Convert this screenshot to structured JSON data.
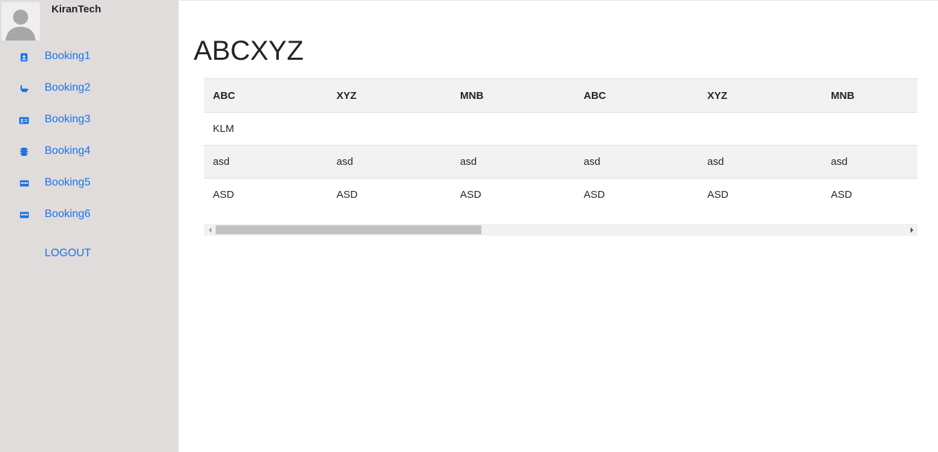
{
  "user": {
    "name": "KiranTech"
  },
  "sidebar": {
    "items": [
      {
        "label": "Booking1",
        "icon": "id-badge-icon"
      },
      {
        "label": "Booking2",
        "icon": "bath-icon"
      },
      {
        "label": "Booking3",
        "icon": "id-card-icon"
      },
      {
        "label": "Booking4",
        "icon": "microchip-icon"
      },
      {
        "label": "Booking5",
        "icon": "credit-card-icon"
      },
      {
        "label": "Booking6",
        "icon": "credit-card-icon"
      }
    ],
    "logout": "LOGOUT"
  },
  "main": {
    "title": "ABCXYZ",
    "table": {
      "headers": [
        "ABC",
        "XYZ",
        "MNB",
        "ABC",
        "XYZ",
        "MNB"
      ],
      "rows": [
        [
          "KLM",
          "",
          "",
          "",
          "",
          ""
        ],
        [
          "asd",
          "asd",
          "asd",
          "asd",
          "asd",
          "asd"
        ],
        [
          "ASD",
          "ASD",
          "ASD",
          "ASD",
          "ASD",
          "ASD"
        ]
      ]
    }
  },
  "colors": {
    "sidebar_bg": "#e0dcdc",
    "link": "#1a73e8",
    "stripe": "#f2f2f2"
  }
}
